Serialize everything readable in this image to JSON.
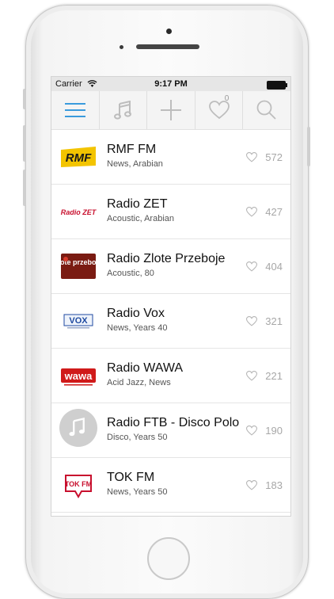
{
  "status": {
    "carrier": "Carrier",
    "time": "9:17 PM"
  },
  "toolbar": {
    "items": [
      {
        "icon": "menu-icon"
      },
      {
        "icon": "music-note-icon"
      },
      {
        "icon": "plus-icon"
      },
      {
        "icon": "heart-icon",
        "badge": "0"
      },
      {
        "icon": "search-icon"
      }
    ],
    "accent": "#3a9bdc"
  },
  "stations": [
    {
      "logo_text": "RMF",
      "name": "RMF FM",
      "genres": "News, Arabian",
      "likes": "572"
    },
    {
      "logo_text": "Radio ZET",
      "name": "Radio ZET",
      "genres": "Acoustic, Arabian",
      "likes": "427"
    },
    {
      "logo_text": "złote przeboje",
      "name": "Radio Zlote Przeboje",
      "genres": "Acoustic, 80",
      "likes": "404"
    },
    {
      "logo_text": "VOX",
      "name": "Radio Vox",
      "genres": "News, Years 40",
      "likes": "321"
    },
    {
      "logo_text": "wawa",
      "name": "Radio WAWA",
      "genres": "Acid Jazz, News",
      "likes": "221"
    },
    {
      "logo_text": "",
      "name": "Radio FTB - Disco Polo",
      "genres": "Disco, Years 50",
      "likes": "190"
    },
    {
      "logo_text": "TOK FM",
      "name": "TOK FM",
      "genres": "News, Years 50",
      "likes": "183"
    }
  ]
}
